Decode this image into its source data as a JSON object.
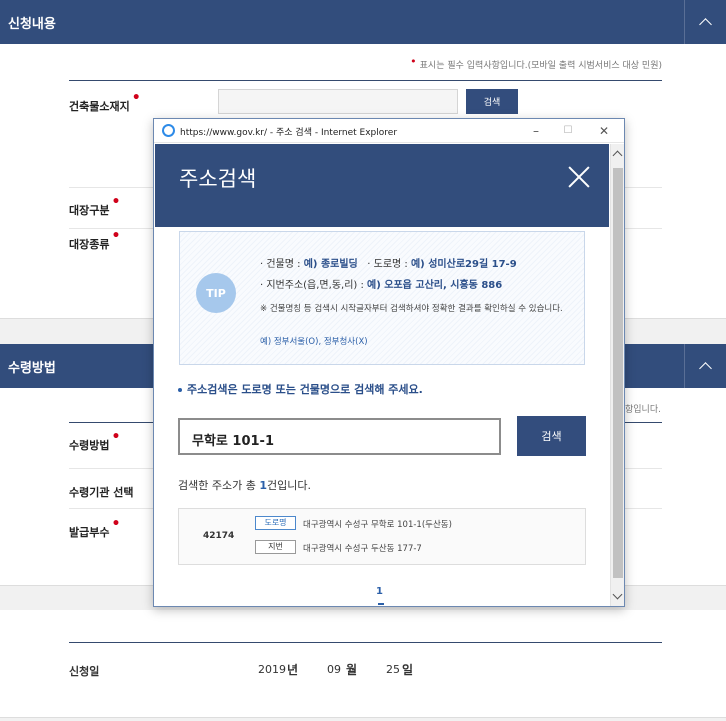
{
  "section1": {
    "title": "신청내용",
    "required_note": "표시는 필수 입력사항입니다.(모바일 출력 시범서비스 대상 민원)",
    "fields": [
      {
        "label": "건축물소재지"
      },
      {
        "label": "대장구분"
      },
      {
        "label": "대장종류"
      }
    ],
    "search_button": "검색"
  },
  "section2": {
    "title": "수령방법",
    "note_tail": "항입니다.",
    "fields": [
      {
        "label": "수령방법"
      },
      {
        "label": "수령기관 선택"
      },
      {
        "label": "발급부수"
      }
    ]
  },
  "section3": {
    "date_label": "신청일",
    "year": "2019",
    "year_unit": "년",
    "month": "09",
    "month_unit": "월",
    "day": "25",
    "day_unit": "일"
  },
  "popup": {
    "window_title": "https://www.gov.kr/ - 주소 검색 - Internet Explorer",
    "title": "주소검색",
    "tip": {
      "badge": "TIP",
      "line1_a": "· 건물명 : ",
      "line1_b": "예) 종로빌딩",
      "line1_c": "   · 도로명 : ",
      "line1_d": "예) 성미산로29길 17-9",
      "line2_a": "· 지번주소(읍,면,동,리) : ",
      "line2_b": "예) 오포읍 고산리, 시흥동 886",
      "note": "※ 건물명칭 등 검색시 시작글자부터 검색하셔야 정확한 결과를 확인하실 수 있습니다.",
      "example": "예) 정부서울(O), 정부청사(X)"
    },
    "guide": "주소검색은 도로명 또는 건물명으로 검색해 주세요.",
    "query": "무학로 101-1",
    "search_button": "검색",
    "count_prefix": "검색한 주소가 총 ",
    "count": "1",
    "count_suffix": "건입니다.",
    "results": [
      {
        "zip": "42174",
        "road_tag": "도로명",
        "road_addr": "대구광역시 수성구 무학로 101-1(두산동)",
        "jibun_tag": "지번",
        "jibun_addr": "대구광역시 수성구 두산동 177-7"
      }
    ],
    "page": "1"
  },
  "colors": {
    "primary": "#324d7c",
    "link": "#2b5fa8",
    "required": "#d0021b"
  }
}
